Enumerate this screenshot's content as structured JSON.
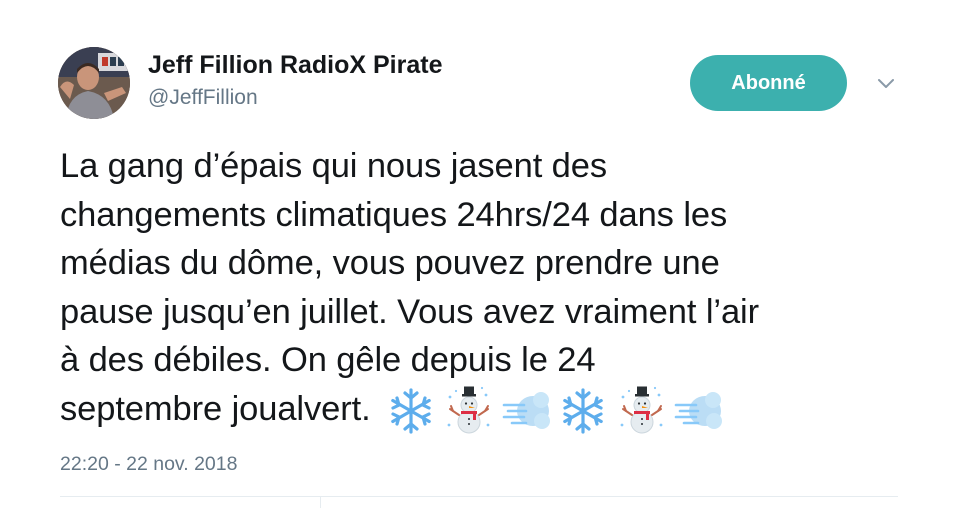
{
  "author": {
    "display_name": "Jeff Fillion RadioX Pirate",
    "handle": "@JeffFillion"
  },
  "follow_button": {
    "label": "Abonné",
    "color": "#3cb0ae"
  },
  "menu": {
    "icon": "chevron-down-icon"
  },
  "tweet": {
    "lines": [
      "La gang d’épais qui nous jasent des",
      "changements climatiques 24hrs/24 dans les",
      "médias du dôme, vous pouvez prendre une",
      "pause jusqu’en juillet. Vous avez vraiment l’air",
      "à des débiles. On gêle depuis le 24",
      "septembre joualvert."
    ],
    "emojis": [
      "snowflake-emoji",
      "snowman-emoji",
      "wind-face-emoji",
      "snowflake-emoji",
      "snowman-emoji",
      "wind-face-emoji"
    ]
  },
  "timestamp": "22:20 - 22 nov. 2018",
  "colors": {
    "text": "#14171a",
    "muted": "#657786",
    "divider": "#e6ecf0",
    "accent": "#3cb0ae"
  }
}
